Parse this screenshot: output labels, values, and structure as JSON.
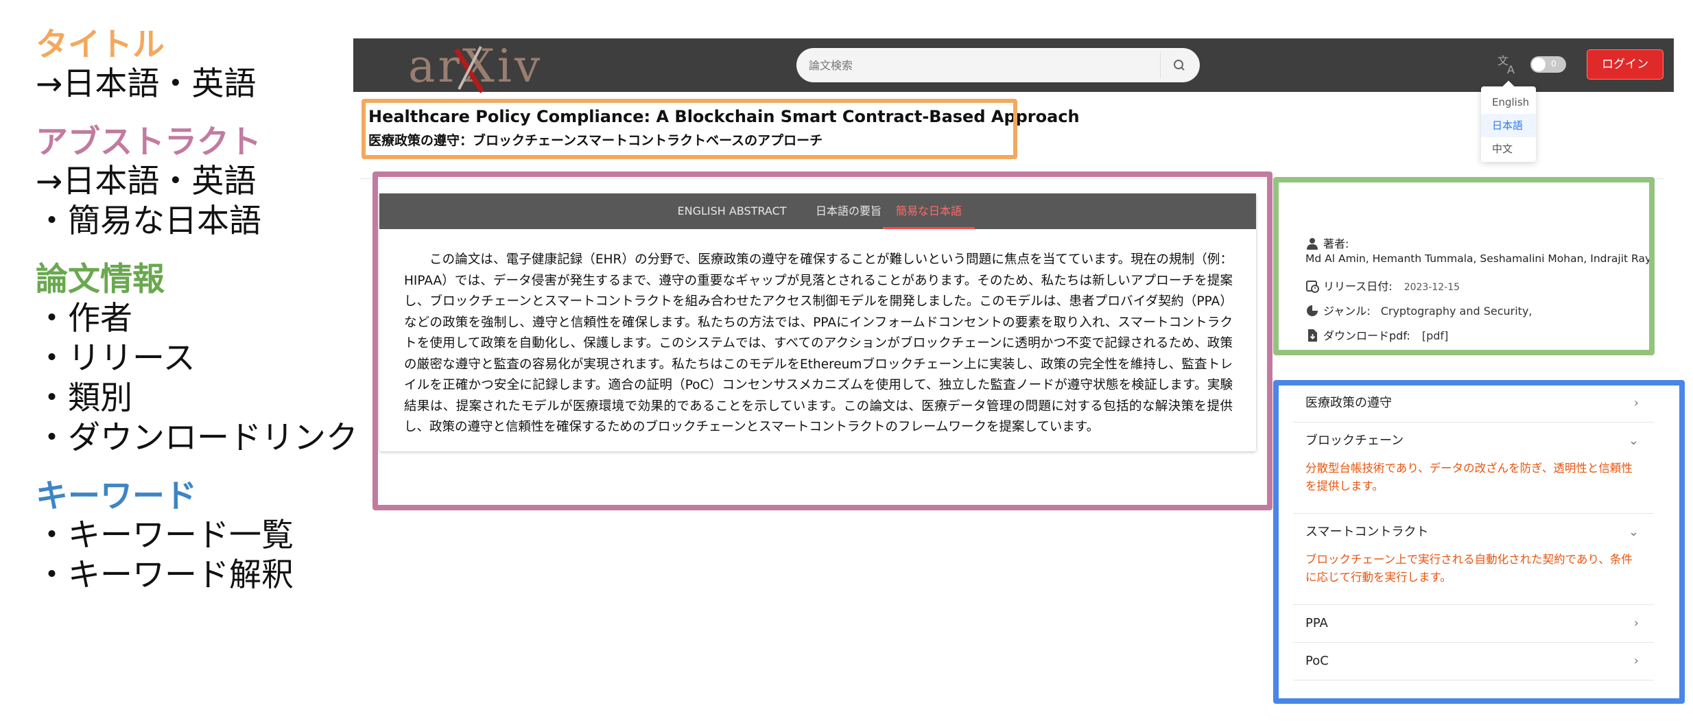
{
  "legend": {
    "title": {
      "heading": "タイトル",
      "items": [
        "→日本語・英語"
      ]
    },
    "abstract": {
      "heading": "アブストラクト",
      "items": [
        "→日本語・英語",
        "・簡易な日本語"
      ]
    },
    "paper_info": {
      "heading": "論文情報",
      "items": [
        "・作者",
        "・リリース",
        "・類別",
        "・ダウンロードリンク"
      ]
    },
    "keywords": {
      "heading": "キーワード",
      "items": [
        "・キーワード一覧",
        "・キーワード解釈"
      ]
    }
  },
  "colors": {
    "title": "#f4a85c",
    "abstract": "#c27ba0",
    "paper_info": "#93c47d",
    "keywords": "#4a86e8"
  },
  "header": {
    "logo": "arXiv",
    "search_placeholder": "論文検索",
    "search_icon": "search-icon",
    "translate_icon": "translate-icon",
    "toggle_text": "0",
    "login_label": "ログイン",
    "languages": [
      "English",
      "日本語",
      "中文"
    ],
    "selected_language": "日本語"
  },
  "paper": {
    "title_en": "Healthcare Policy Compliance: A Blockchain Smart Contract-Based Approach",
    "title_ja": "医療政策の遵守：ブロックチェーンスマートコントラクトベースのアプローチ"
  },
  "abstract": {
    "tabs": [
      "ENGLISH ABSTRACT",
      "日本語の要旨",
      "簡易な日本語"
    ],
    "active_tab": "簡易な日本語",
    "text": "この論文は、電子健康記録（EHR）の分野で、医療政策の遵守を確保することが難しいという問題に焦点を当てています。現在の規制（例：HIPAA）では、データ侵害が発生するまで、遵守の重要なギャップが見落とされることがあります。そのため、私たちは新しいアプローチを提案し、ブロックチェーンとスマートコントラクトを組み合わせたアクセス制御モデルを開発しました。このモデルは、患者プロバイダ契約（PPA）などの政策を強制し、遵守と信頼性を確保します。私たちの方法では、PPAにインフォームドコンセントの要素を取り入れ、スマートコントラクトを使用して政策を自動化し、保護します。このシステムでは、すべてのアクションがブロックチェーンに透明かつ不変で記録されるため、政策の厳密な遵守と監査の容易化が実現されます。私たちはこのモデルをEthereumブロックチェーン上に実装し、政策の完全性を維持し、監査トレイルを正確かつ安全に記録します。適合の証明（PoC）コンセンサスメカニズムを使用して、独立した監査ノードが遵守状態を検証します。実験結果は、提案されたモデルが医療環境で効果的であることを示しています。この論文は、医療データ管理の問題に対する包括的な解決策を提供し、政策の遵守と信頼性を確保するためのブロックチェーンとスマートコントラクトのフレームワークを提案しています。"
  },
  "info": {
    "authors_label": "著者:",
    "authors": "Md Al Amin,   Hemanth Tummala,   Seshamalini Mohan,   Indrajit Ray,",
    "release_label": "リリース日付:",
    "release_date": "2023-12-15",
    "genre_label": "ジャンル:",
    "genre": "Cryptography and Security,",
    "download_label": "ダウンロードpdf:",
    "download_link": "[pdf]"
  },
  "keywords": [
    {
      "term": "医療政策の遵守",
      "expanded": false,
      "desc": ""
    },
    {
      "term": "ブロックチェーン",
      "expanded": true,
      "desc": "分散型台帳技術であり、データの改ざんを防ぎ、透明性と信頼性を提供します。"
    },
    {
      "term": "スマートコントラクト",
      "expanded": true,
      "desc": "ブロックチェーン上で実行される自動化された契約であり、条件に応じて行動を実行します。"
    },
    {
      "term": "PPA",
      "expanded": false,
      "desc": ""
    },
    {
      "term": "PoC",
      "expanded": false,
      "desc": ""
    }
  ]
}
